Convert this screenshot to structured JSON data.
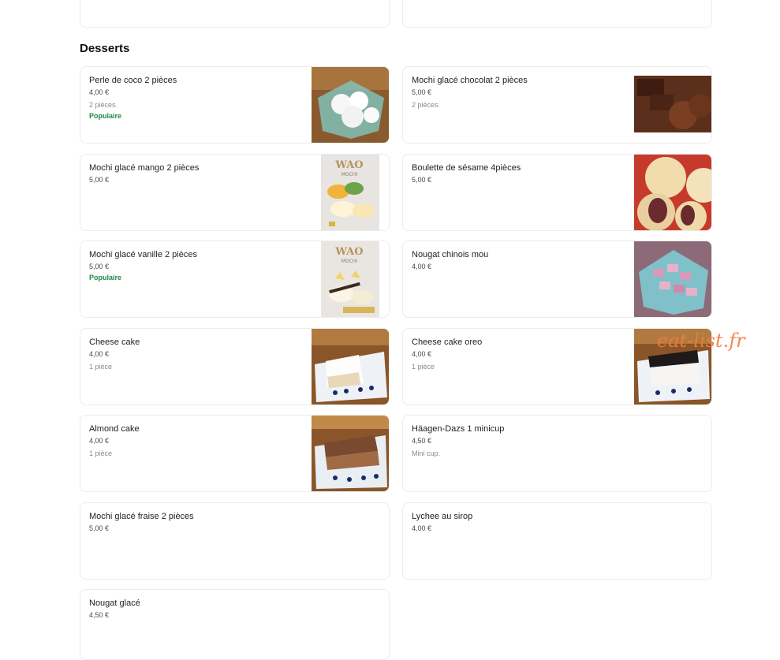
{
  "section": {
    "title": "Desserts"
  },
  "watermark": "eat-list.fr",
  "items": [
    {
      "name": "Perle de coco 2 pièces",
      "price": "4,00 €",
      "desc": "2 pièces.",
      "badge": "Populaire",
      "image": "coconut-mochi-photo"
    },
    {
      "name": "Mochi glacé chocolat 2 pièces",
      "price": "5,00 €",
      "desc": "2 pièces.",
      "image": "chocolate-mochi-photo"
    },
    {
      "name": "Mochi glacé mango 2 pièces",
      "price": "5,00 €",
      "image": "mango-mochi-box-photo",
      "image_text": "WAO",
      "image_subtext": "MOCHI"
    },
    {
      "name": "Boulette de sésame 4pièces",
      "price": "5,00 €",
      "image": "sesame-ball-photo"
    },
    {
      "name": "Mochi glacé vanille 2 pièces",
      "price": "5,00 €",
      "badge": "Populaire",
      "image": "vanilla-mochi-box-photo",
      "image_text": "WAO",
      "image_subtext": "MOCHI"
    },
    {
      "name": "Nougat chinois mou",
      "price": "4,00 €",
      "image": "nougat-photo"
    },
    {
      "name": "Cheese cake",
      "price": "4,00 €",
      "desc": "1 pièce",
      "image": "cheesecake-photo"
    },
    {
      "name": "Cheese cake oreo",
      "price": "4,00 €",
      "desc": "1 pièce",
      "image": "oreo-cheesecake-photo"
    },
    {
      "name": "Almond cake",
      "price": "4,00 €",
      "desc": "1 pièce",
      "image": "almond-cake-photo"
    },
    {
      "name": "Häagen-Dazs 1 minicup",
      "price": "4,50 €",
      "desc": "Mini cup."
    },
    {
      "name": "Mochi glacé fraise 2 pièces",
      "price": "5,00 €"
    },
    {
      "name": "Lychee au sirop",
      "price": "4,00 €"
    },
    {
      "name": "Nougat glacé",
      "price": "4,50 €"
    }
  ],
  "colors": {
    "badge": "#1e8a4a",
    "watermark": "#f07c3c"
  }
}
